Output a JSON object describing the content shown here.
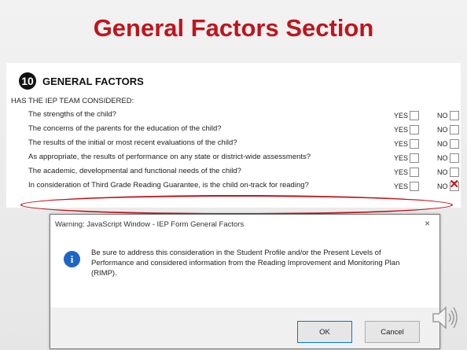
{
  "slide": {
    "title": "General Factors Section"
  },
  "form": {
    "section_number": "10",
    "section_title": "GENERAL FACTORS",
    "team_question": "HAS THE IEP TEAM CONSIDERED:",
    "yes_label": "YES",
    "no_label": "NO",
    "rows": [
      {
        "question": "The strengths of the child?",
        "checked": ""
      },
      {
        "question": "The concerns of the parents for the education of the child?",
        "checked": ""
      },
      {
        "question": "The results of the initial or most recent evaluations of the child?",
        "checked": ""
      },
      {
        "question": "As appropriate, the results of performance on any state or district-wide assessments?",
        "checked": ""
      },
      {
        "question": "The academic, developmental and functional needs of the child?",
        "checked": ""
      },
      {
        "question": "In consideration of Third Grade Reading Guarantee, is the child on-track for reading?",
        "checked": "NO"
      }
    ]
  },
  "dialog": {
    "title": "Warning: JavaScript Window - IEP Form General Factors",
    "close_glyph": "×",
    "message": "Be sure to address this consideration in the Student Profile and/or the Present Levels of Performance and considered information from the Reading Improvement and Monitoring Plan (RIMP).",
    "ok_label": "OK",
    "cancel_label": "Cancel"
  },
  "colors": {
    "title_red": "#c0141c",
    "mark_red": "#d01010",
    "info_blue": "#1c66c4"
  },
  "icons": {
    "section": "number-badge-icon",
    "dialog": "info-icon",
    "audio": "speaker-icon"
  }
}
